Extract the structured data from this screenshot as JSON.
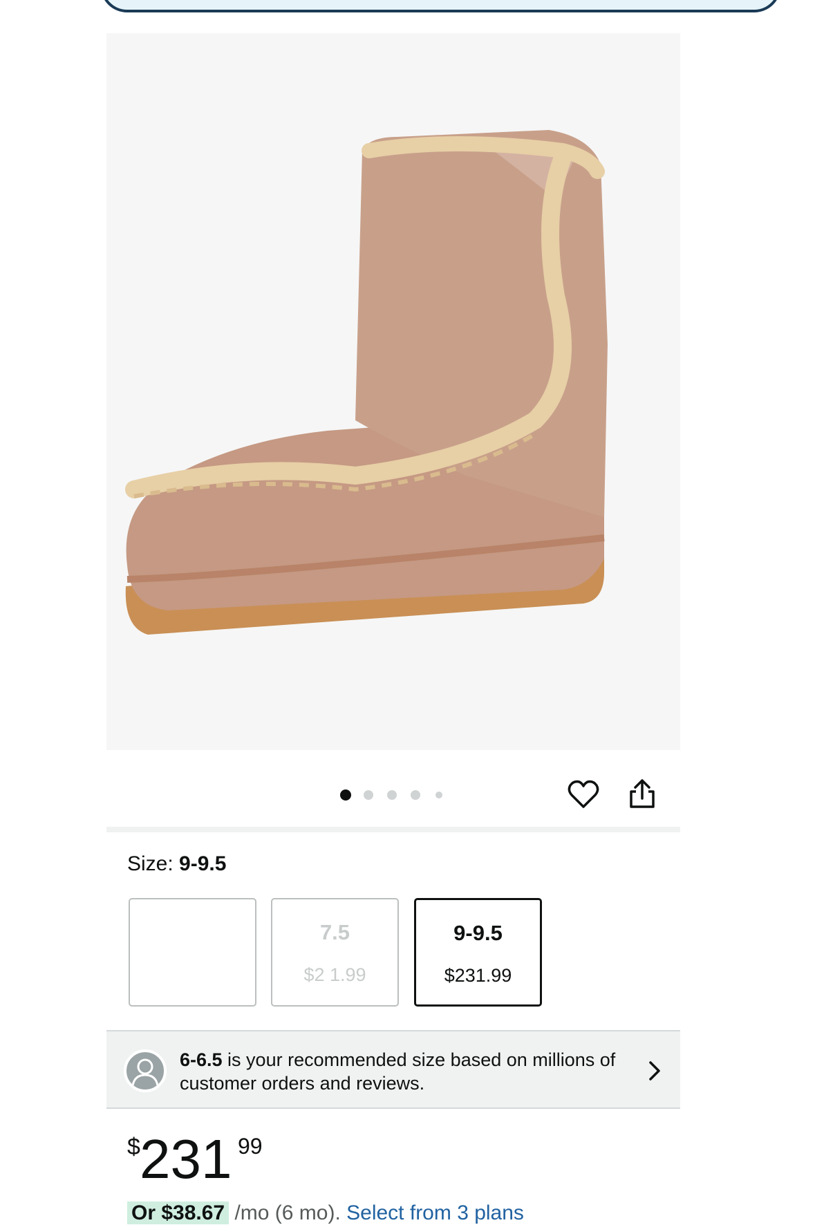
{
  "product": {
    "image_alt": "Pink suede shearling boot with crochet trim",
    "carousel": {
      "total": 5,
      "active_index": 0
    }
  },
  "actions": {
    "wishlist_icon": "heart-icon",
    "share_icon": "share-icon"
  },
  "size": {
    "label_prefix": "Size: ",
    "selected": "9-9.5",
    "options": [
      {
        "name": "",
        "price": "$",
        "state": "blank"
      },
      {
        "name": "7.5",
        "price": "$2 1.99",
        "state": "faded"
      },
      {
        "name": "9-9.5",
        "price": "$231.99",
        "state": "selected"
      }
    ]
  },
  "recommendation": {
    "size": "6-6.5",
    "text": " is your recommended size based on millions of customer orders and reviews."
  },
  "price": {
    "symbol": "$",
    "whole": "231",
    "fraction": "99"
  },
  "financing": {
    "amount": "Or $38.67",
    "term": " /mo (6 mo). ",
    "link": "Select from 3 plans"
  },
  "colors": {
    "accent_link": "#2162a1",
    "deal_bg": "#cfeee0",
    "selected_border": "#0f1111"
  }
}
